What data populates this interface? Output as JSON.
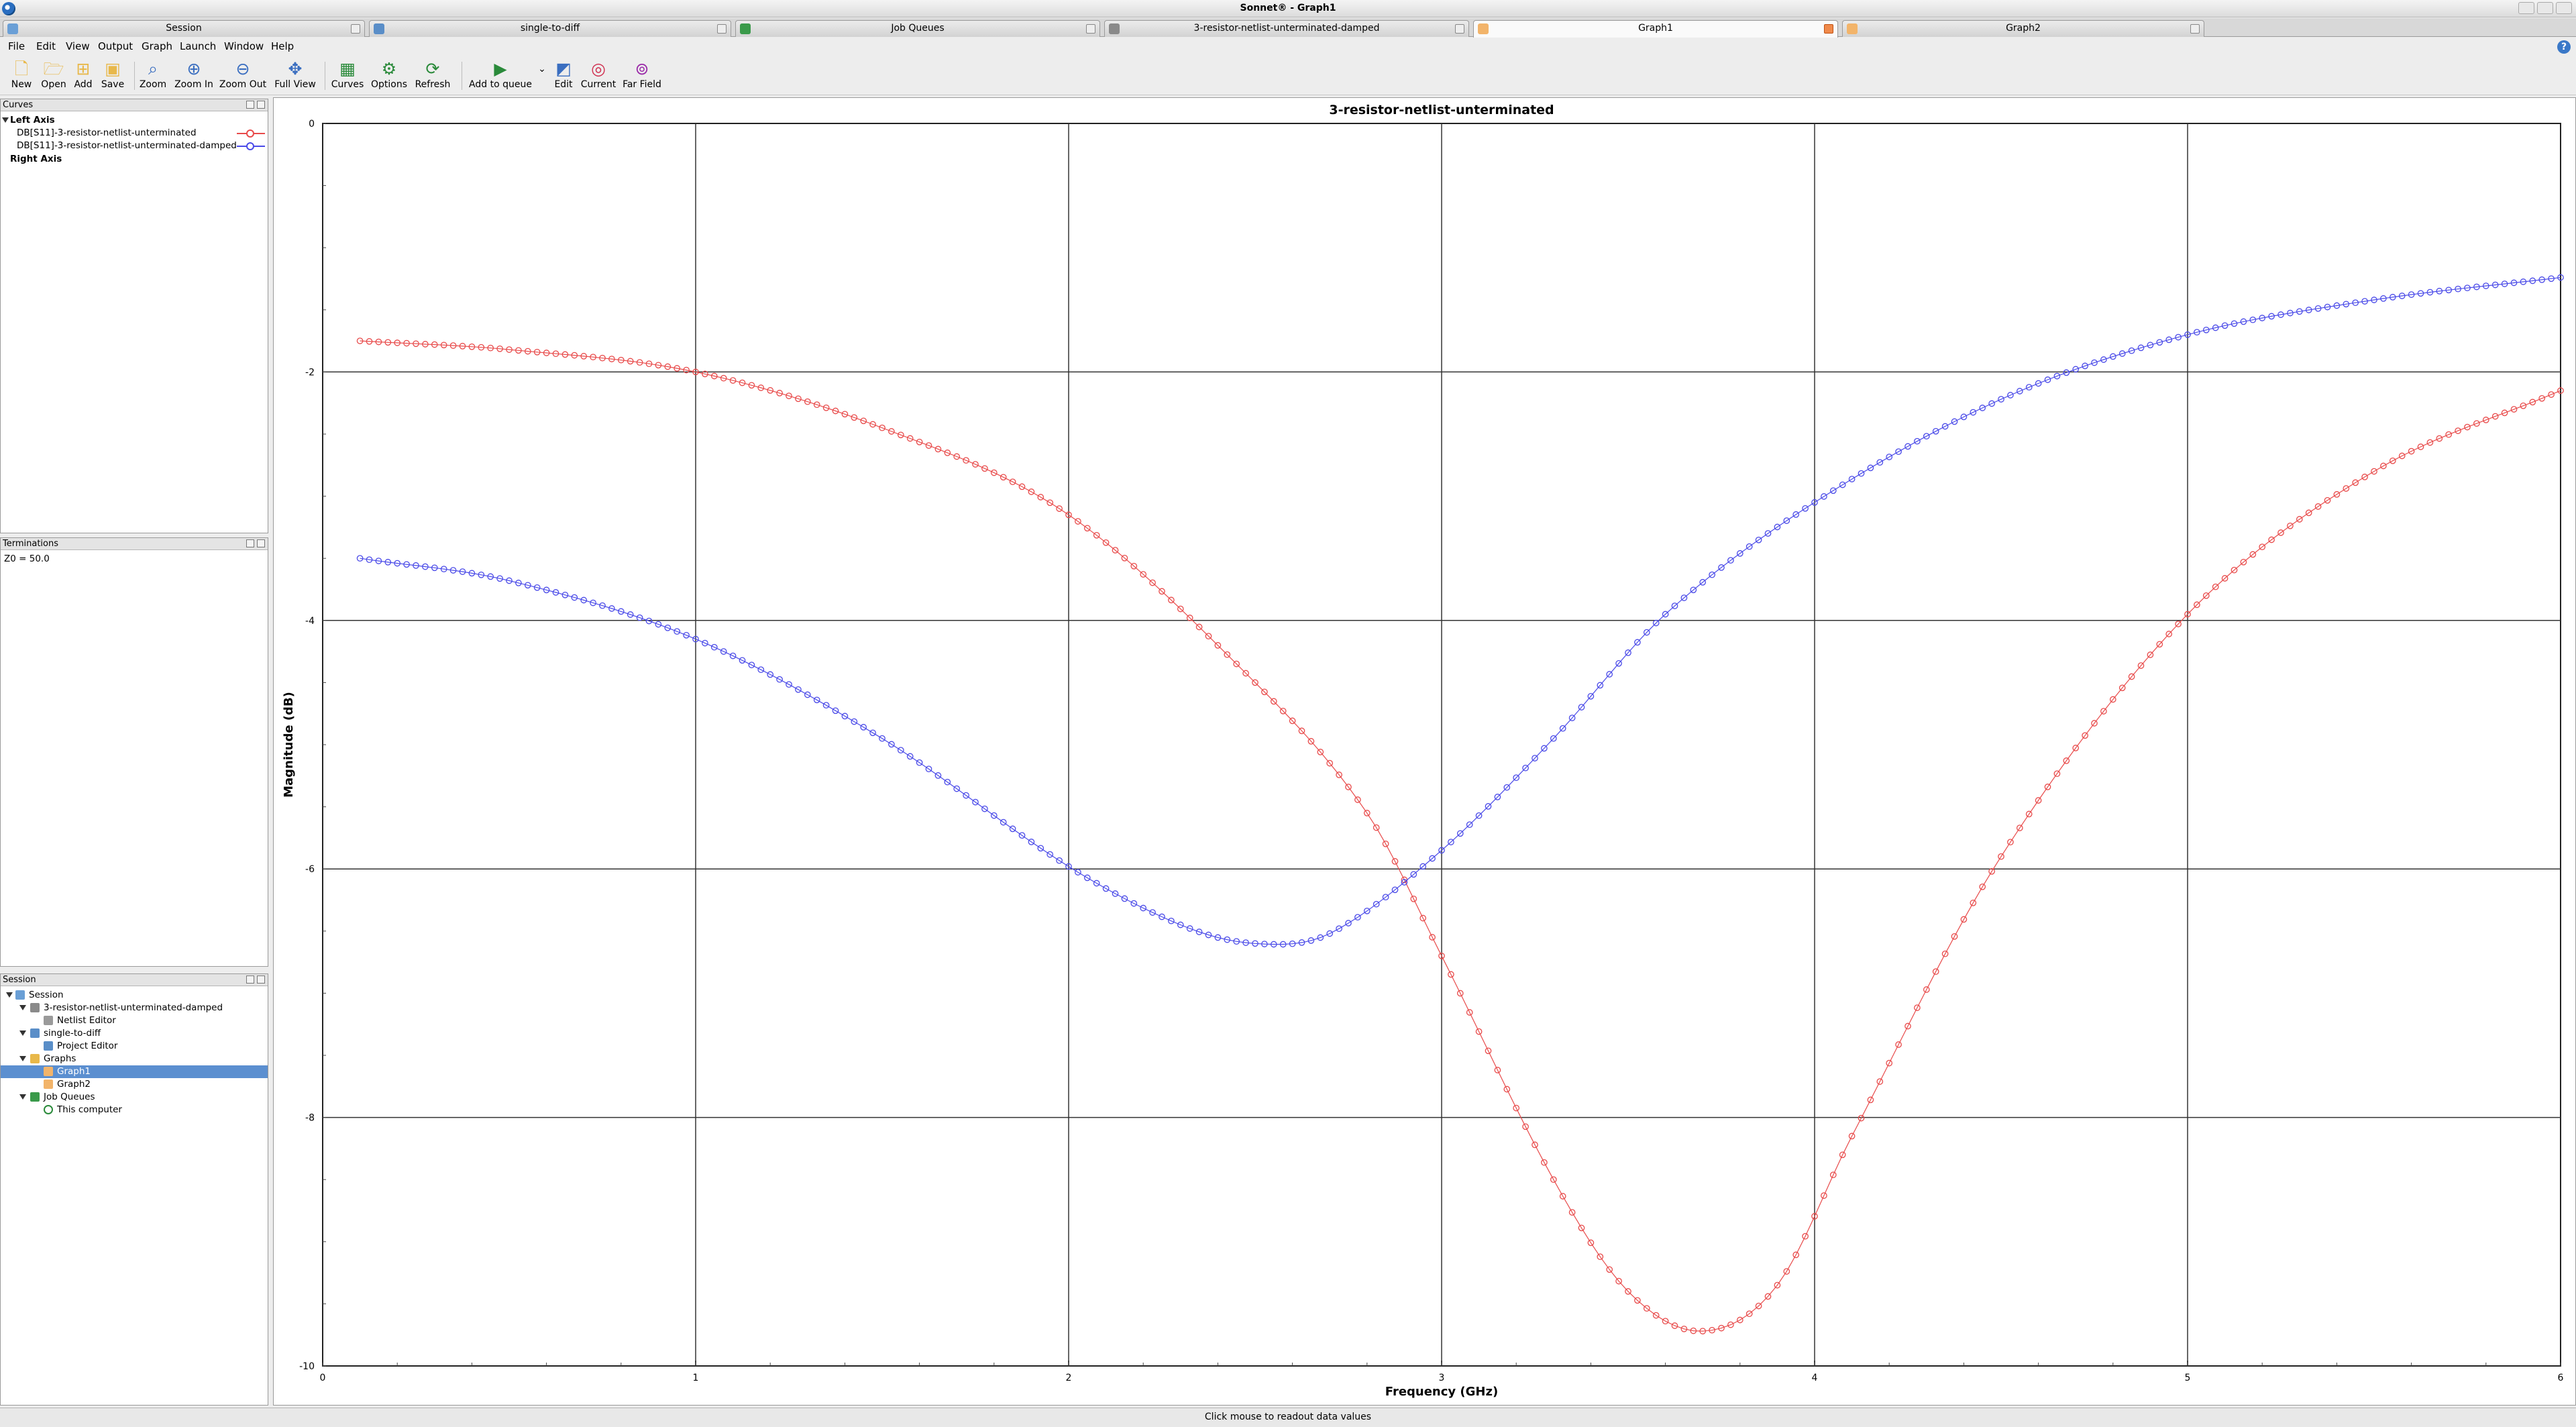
{
  "window": {
    "title": "Sonnet® - Graph1"
  },
  "tabs": [
    {
      "label": "Session",
      "icon": "session-icon"
    },
    {
      "label": "single-to-diff",
      "icon": "project-icon"
    },
    {
      "label": "Job Queues",
      "icon": "job-queue-icon"
    },
    {
      "label": "3-resistor-netlist-unterminated-damped",
      "icon": "netlist-icon"
    },
    {
      "label": "Graph1",
      "icon": "graph-icon",
      "active": true
    },
    {
      "label": "Graph2",
      "icon": "graph-icon"
    }
  ],
  "menu": [
    "File",
    "Edit",
    "View",
    "Output",
    "Graph",
    "Launch",
    "Window",
    "Help"
  ],
  "toolbar": {
    "new": "New",
    "open": "Open",
    "add": "Add",
    "save": "Save",
    "zoom": "Zoom",
    "zoom_in": "Zoom In",
    "zoom_out": "Zoom Out",
    "full_view": "Full View",
    "curves": "Curves",
    "options": "Options",
    "refresh": "Refresh",
    "add_to_queue": "Add to queue",
    "edit": "Edit",
    "current": "Current",
    "far_field": "Far Field"
  },
  "curves_panel": {
    "title": "Curves",
    "left_axis": "Left Axis",
    "right_axis": "Right Axis",
    "items": [
      {
        "label": "DB[S11]-3-resistor-netlist-unterminated",
        "color": "#e84a4a"
      },
      {
        "label": "DB[S11]-3-resistor-netlist-unterminated-damped",
        "color": "#4a4ae8"
      }
    ]
  },
  "terminations_panel": {
    "title": "Terminations",
    "value": "Z0 = 50.0"
  },
  "session_panel": {
    "title": "Session",
    "items": [
      {
        "label": "Session",
        "level": 0,
        "expanded": true,
        "icon": "session-icon"
      },
      {
        "label": "3-resistor-netlist-unterminated-damped",
        "level": 1,
        "expanded": true,
        "icon": "netlist-icon"
      },
      {
        "label": "Netlist Editor",
        "level": 2,
        "icon": "netlist-editor-icon"
      },
      {
        "label": "single-to-diff",
        "level": 1,
        "expanded": true,
        "icon": "project-icon"
      },
      {
        "label": "Project Editor",
        "level": 2,
        "icon": "project-editor-icon"
      },
      {
        "label": "Graphs",
        "level": 1,
        "expanded": true,
        "icon": "folder-icon"
      },
      {
        "label": "Graph1",
        "level": 2,
        "icon": "graph-icon",
        "selected": true
      },
      {
        "label": "Graph2",
        "level": 2,
        "icon": "graph-icon"
      },
      {
        "label": "Job Queues",
        "level": 1,
        "expanded": true,
        "icon": "job-queue-icon"
      },
      {
        "label": "This computer",
        "level": 2,
        "icon": "computer-check-icon"
      }
    ]
  },
  "status": "Click mouse to readout data values",
  "chart_data": {
    "type": "scatter",
    "title": "3-resistor-netlist-unterminated",
    "xlabel": "Frequency (GHz)",
    "ylabel": "Magnitude (dB)",
    "xlim": [
      0,
      6
    ],
    "ylim": [
      -10,
      0
    ],
    "xticks": [
      "0",
      "1",
      "2",
      "3",
      "4",
      "5",
      "6"
    ],
    "yticks": [
      "0",
      "-2",
      "-4",
      "-6",
      "-8",
      "-10"
    ],
    "grid": true,
    "marker": "circle",
    "series": [
      {
        "name": "DB[S11]-3-resistor-netlist-unterminated",
        "color": "#e84a4a",
        "x": [
          0.1,
          0.5,
          1.0,
          1.5,
          2.0,
          2.5,
          2.8,
          3.0,
          3.3,
          3.5,
          3.7,
          3.9,
          4.1,
          4.5,
          5.0,
          5.5,
          6.0
        ],
        "y": [
          -1.75,
          -1.82,
          -2.0,
          -2.45,
          -3.15,
          -4.5,
          -5.55,
          -6.7,
          -8.5,
          -9.4,
          -9.72,
          -9.35,
          -8.15,
          -5.9,
          -3.95,
          -2.8,
          -2.15
        ]
      },
      {
        "name": "DB[S11]-3-resistor-netlist-unterminated-damped",
        "color": "#4a4ae8",
        "x": [
          0.1,
          0.5,
          1.0,
          1.5,
          2.0,
          2.3,
          2.5,
          2.7,
          3.0,
          3.3,
          3.6,
          4.0,
          4.5,
          5.0,
          5.5,
          6.0
        ],
        "y": [
          -3.5,
          -3.68,
          -4.15,
          -4.95,
          -5.98,
          -6.45,
          -6.6,
          -6.52,
          -5.85,
          -4.95,
          -3.95,
          -3.05,
          -2.22,
          -1.7,
          -1.42,
          -1.24
        ]
      }
    ]
  }
}
